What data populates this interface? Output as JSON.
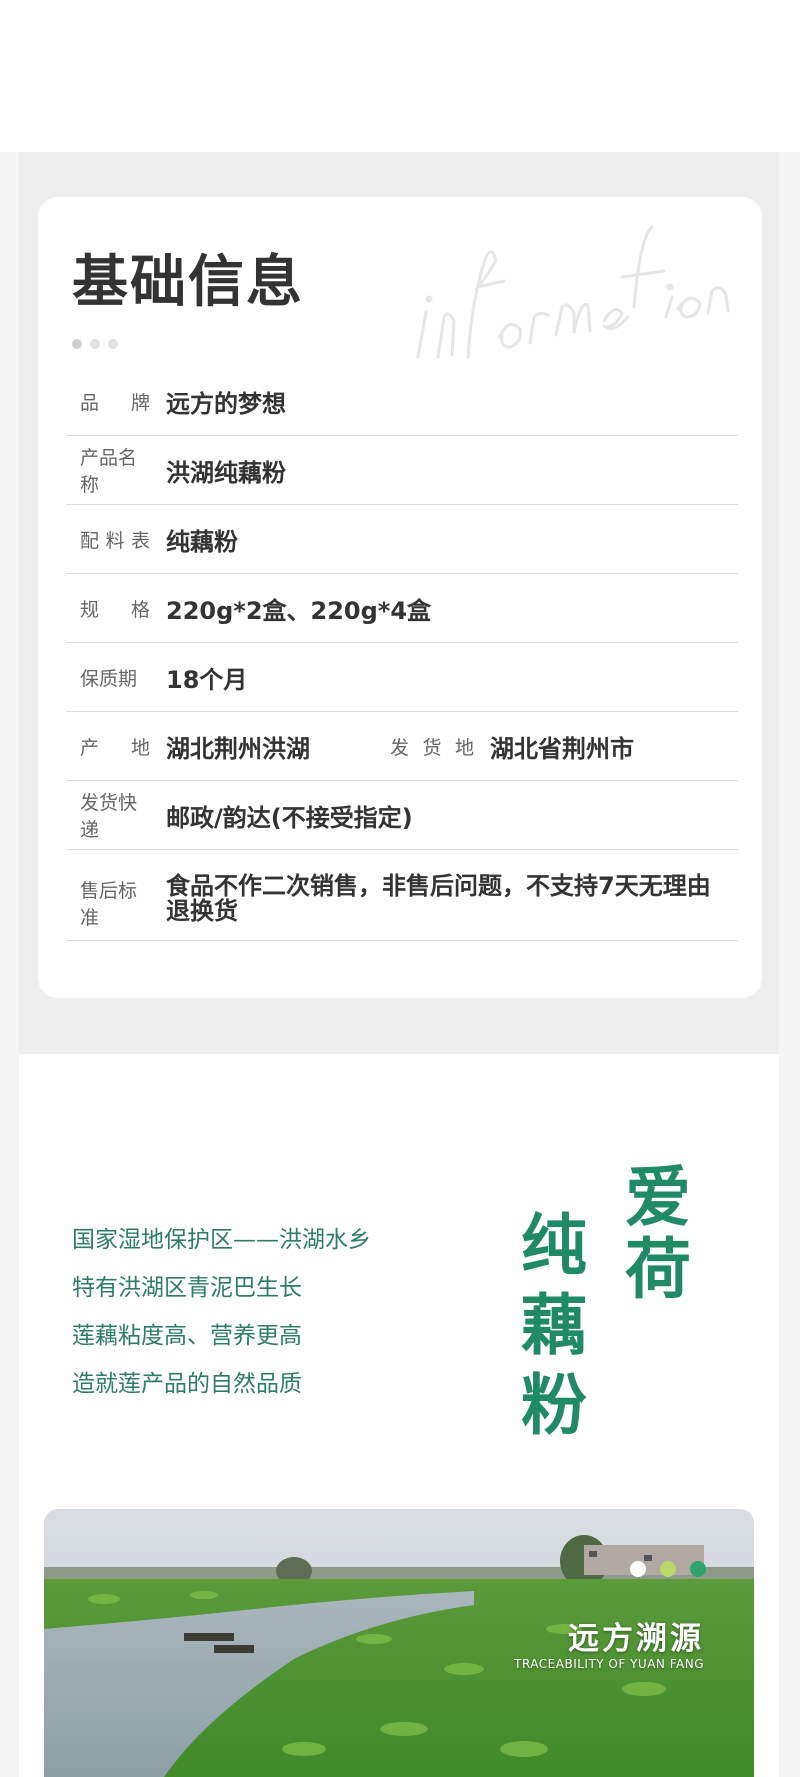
{
  "info": {
    "title": "基础信息",
    "watermark_text": "information",
    "rows": [
      {
        "label_chars": [
          "品",
          "牌"
        ],
        "value": "远方的梦想"
      },
      {
        "label_chars": [
          "产品名称"
        ],
        "value": "洪湖纯藕粉"
      },
      {
        "label_chars": [
          "配",
          "料",
          "表"
        ],
        "value": "纯藕粉"
      },
      {
        "label_chars": [
          "规",
          "格"
        ],
        "value": "220g*2盒、220g*4盒"
      },
      {
        "label_chars": [
          "保质期"
        ],
        "value": "18个月"
      },
      {
        "label_chars": [
          "产",
          "地"
        ],
        "value": "湖北荆州洪湖",
        "label2_chars": [
          "发",
          "货",
          "地"
        ],
        "value2": "湖北省荆州市"
      },
      {
        "label_chars": [
          "发货快递"
        ],
        "value": "邮政/韵达(不接受指定)"
      },
      {
        "label_chars": [
          "售后标准"
        ],
        "value": "食品不作二次销售，非售后问题，不支持7天无理由退换货"
      }
    ]
  },
  "intro": {
    "lines": [
      "国家湿地保护区——洪湖水乡",
      "特有洪湖区青泥巴生长",
      "莲藕粘度高、营养更高",
      "造就莲产品的自然品质"
    ],
    "calligraphy_left": "纯藕粉",
    "calligraphy_right": "爱荷"
  },
  "photo": {
    "title": "远方溯源",
    "subtitle": "TRACEABILITY OF YUAN FANG"
  },
  "colors": {
    "accent_green": "#2e7b6a",
    "calligraphy_green": "#1f8a63",
    "dot_white": "#ffffff",
    "dot_light_green": "#b8d86a",
    "dot_dark_green": "#2fa36b"
  }
}
